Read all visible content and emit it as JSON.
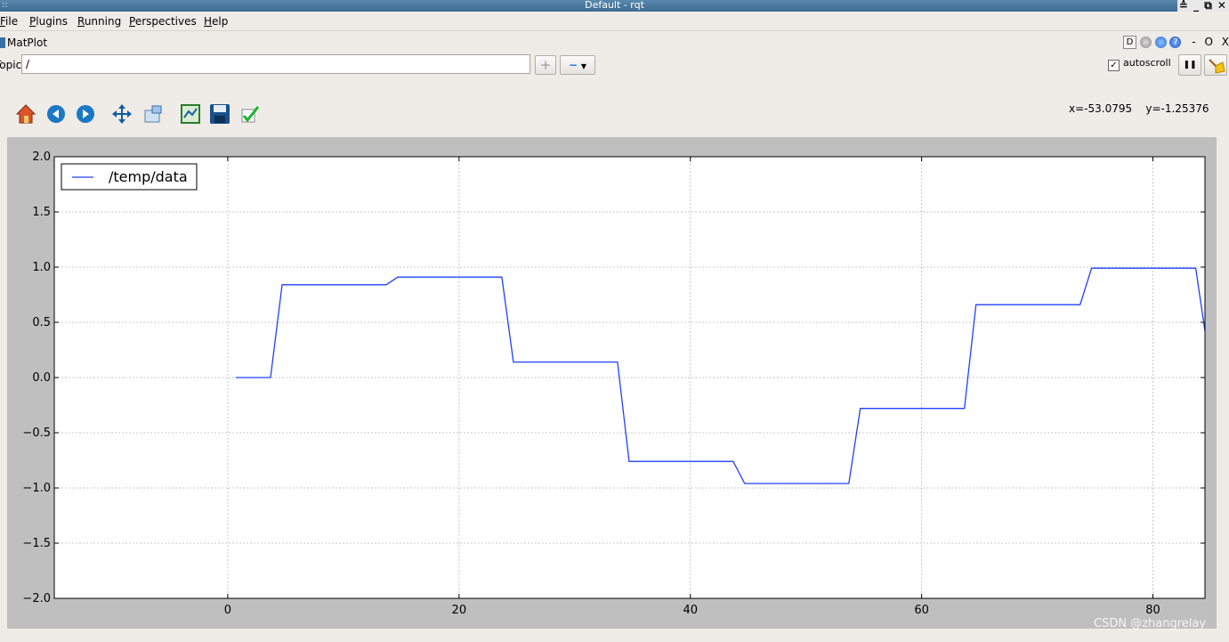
{
  "window": {
    "title": "Default - rqt",
    "sysmenu": "::",
    "buttons": "≙ _ ⧉ ✕"
  },
  "menu": [
    "File",
    "Plugins",
    "Running",
    "Perspectives",
    "Help"
  ],
  "plugin": {
    "title": "MatPlot",
    "help_box": "D",
    "dash": "-",
    "o": "O",
    "x": "X"
  },
  "topic": {
    "label": "Topic",
    "value": "/"
  },
  "add_button": "+",
  "remove_button": "−",
  "autoscroll": {
    "label": "autoscroll",
    "checked": true
  },
  "pause_button": "❚❚",
  "toolbar": [
    "home-icon",
    "back-icon",
    "forward-icon",
    "pan-icon",
    "zoom-icon",
    "subplots-icon",
    "save-icon",
    "edit-icon"
  ],
  "coords": {
    "x": "x=-53.0795",
    "y": "y=-1.25376"
  },
  "watermark": "CSDN @zhangrelay",
  "colors": {
    "line": "#2040ff",
    "frame": "#bfbfbf",
    "window_bg": "#efebe7"
  },
  "chart_data": {
    "type": "line",
    "xlim": [
      -15,
      84.5
    ],
    "ylim": [
      -2.0,
      2.0
    ],
    "grid": true,
    "legend_position": "top-left",
    "xticks": [
      0,
      20,
      40,
      60,
      80
    ],
    "xtick_labels": [
      "0",
      "20",
      "40",
      "60",
      "80"
    ],
    "yticks": [
      2.0,
      1.5,
      1.0,
      0.5,
      0.0,
      -0.5,
      -1.0,
      -1.5,
      -2.0
    ],
    "ytick_labels": [
      "2.0",
      "1.5",
      "1.0",
      "0.5",
      "0.0",
      "−0.5",
      "−1.0",
      "−1.5",
      "−2.0"
    ],
    "series": [
      {
        "name": "/temp/data",
        "x": [
          0.7,
          3.7,
          4.7,
          13.7,
          14.7,
          23.7,
          24.7,
          33.7,
          34.7,
          43.7,
          44.7,
          53.7,
          54.7,
          63.7,
          64.7,
          73.7,
          74.7,
          83.7,
          84.5
        ],
        "y": [
          0.0,
          0.0,
          0.84,
          0.84,
          0.91,
          0.91,
          0.14,
          0.14,
          -0.76,
          -0.76,
          -0.96,
          -0.96,
          -0.28,
          -0.28,
          0.66,
          0.66,
          0.99,
          0.99,
          0.42
        ]
      }
    ]
  }
}
